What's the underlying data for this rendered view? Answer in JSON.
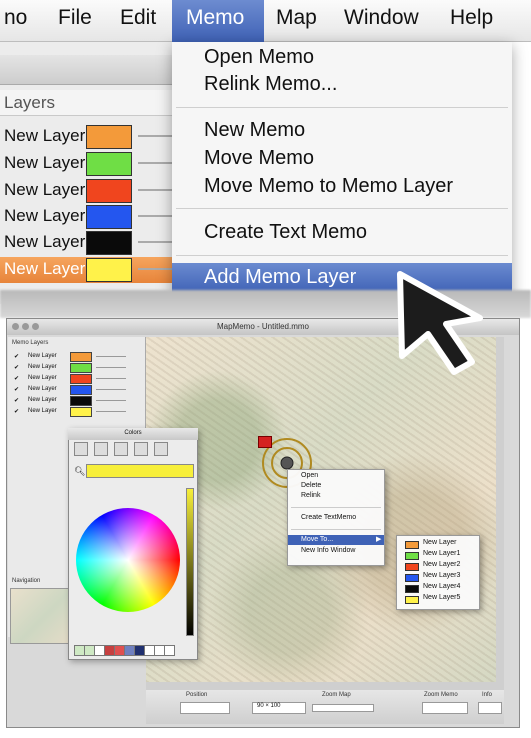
{
  "menubar": {
    "app_partial": "no",
    "file": "File",
    "edit": "Edit",
    "memo": "Memo",
    "map": "Map",
    "window": "Window",
    "help": "Help"
  },
  "layers_panel": {
    "header": "Layers",
    "rows": [
      {
        "label": "New Layer",
        "color": "#f39a3a"
      },
      {
        "label": "New Layer",
        "color": "#6fde45"
      },
      {
        "label": "New Layer",
        "color": "#f0451e"
      },
      {
        "label": "New Layer",
        "color": "#2456ef"
      },
      {
        "label": "New Layer",
        "color": "#0a0a0a"
      },
      {
        "label": "New Layer",
        "color": "#fff24a"
      }
    ]
  },
  "memo_menu": {
    "open_memo": "Open Memo",
    "relink_memo": "Relink Memo...",
    "new_memo": "New Memo",
    "move_memo": "Move Memo",
    "move_memo_to_layer": "Move Memo to Memo Layer",
    "create_text_memo": "Create Text Memo",
    "add_memo_layer": "Add Memo Layer"
  },
  "app_window": {
    "title": "MapMemo - Untitled.mmo",
    "sidebar": {
      "memo_layers_label": "Memo Layers",
      "rows": [
        {
          "label": "New Layer",
          "color": "#f39a3a"
        },
        {
          "label": "New Layer",
          "color": "#6fde45"
        },
        {
          "label": "New Layer",
          "color": "#f0451e"
        },
        {
          "label": "New Layer",
          "color": "#2456ef"
        },
        {
          "label": "New Layer",
          "color": "#0a0a0a"
        },
        {
          "label": "New Layer",
          "color": "#fff24a"
        }
      ],
      "navigation_label": "Navigation"
    },
    "colors_panel": {
      "title": "Colors"
    },
    "context_menu": {
      "open": "Open",
      "delete": "Delete",
      "relink": "Relink",
      "create_text_memo": "Create TextMemo",
      "move_to": "Move To...",
      "new_info_window": "New Info Window"
    },
    "submenu": [
      {
        "label": "New Layer",
        "color": "#f39a3a"
      },
      {
        "label": "New Layer1",
        "color": "#6fde45"
      },
      {
        "label": "New Layer2",
        "color": "#f0451e"
      },
      {
        "label": "New Layer3",
        "color": "#2456ef"
      },
      {
        "label": "New Layer4",
        "color": "#0a0a0a"
      },
      {
        "label": "New Layer5",
        "color": "#fff24a"
      }
    ],
    "toolbar": {
      "position_label": "Position",
      "zoom_map_label": "Zoom Map",
      "zoom_memo_label": "Zoom Memo",
      "info_label": "Info",
      "size_value": "90 × 100"
    }
  }
}
